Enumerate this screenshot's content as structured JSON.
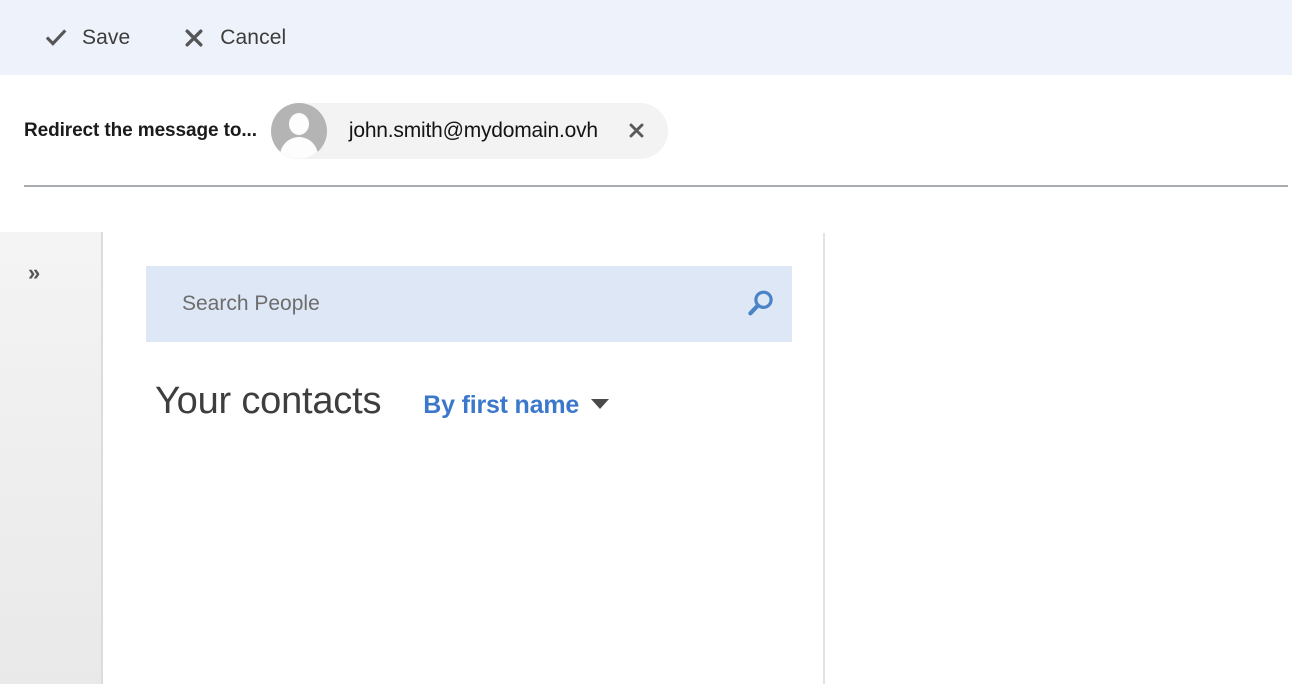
{
  "toolbar": {
    "background_color": "#eef2fb",
    "buttons": [
      {
        "label": "Save",
        "icon": "checkmark-icon",
        "glyph": "✔"
      },
      {
        "label": "Cancel",
        "icon": "close-x-icon",
        "glyph": "✖"
      }
    ]
  },
  "redirect": {
    "label": "Redirect the message to...",
    "recipient": {
      "email": "john.smith@mydomain.ovh",
      "avatar_icon": "person-avatar-icon",
      "remove_icon": "close-x-icon",
      "remove_glyph": "✕",
      "pill_background": "#f3f3f3",
      "avatar_color": "#b4b4b4"
    }
  },
  "side_rail": {
    "expand_icon": "chevron-double-right-icon",
    "expand_glyph": "»"
  },
  "people_picker": {
    "search": {
      "placeholder": "Search People",
      "value": "",
      "icon": "search-magnifier-icon",
      "background_color": "#dde7f5",
      "icon_color": "#4a83c6"
    },
    "contacts_title": "Your contacts",
    "sort": {
      "label": "By first name",
      "caret_icon": "chevron-down-icon",
      "accent_color": "#3b78cc",
      "options": [
        "By first name"
      ]
    },
    "contacts": []
  }
}
